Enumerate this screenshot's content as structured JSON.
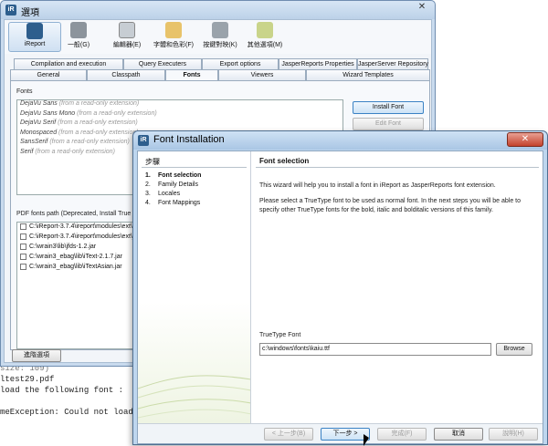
{
  "console": {
    "lines": [
      "size: 109)",
      "ltest29.pdf",
      "load the following font :",
      "",
      "meException: Could not load the fo"
    ]
  },
  "options_window": {
    "title": "選項",
    "toolbar": [
      {
        "label": "iReport",
        "icon": "ireport-icon"
      },
      {
        "label": "一般(G)",
        "icon": "wrench-icon"
      },
      {
        "label": "編輯器(E)",
        "icon": "editor-icon"
      },
      {
        "label": "字體和色彩(F)",
        "icon": "fonts-colors-icon"
      },
      {
        "label": "按鍵對映(K)",
        "icon": "keymap-icon"
      },
      {
        "label": "其他選項(M)",
        "icon": "misc-icon"
      }
    ],
    "tabs_row1": [
      "Compilation and execution",
      "Query Executers",
      "Export options",
      "JasperReports Properties",
      "JasperServer Repository"
    ],
    "tabs_row2": [
      "General",
      "Classpath",
      "Fonts",
      "Viewers",
      "Wizard Templates"
    ],
    "fonts_label": "Fonts",
    "fonts": [
      {
        "name": "DejaVu Sans",
        "note": "(from a read-only extension)"
      },
      {
        "name": "DejaVu Sans Mono",
        "note": "(from a read-only extension)"
      },
      {
        "name": "DejaVu Serif",
        "note": "(from a read-only extension)"
      },
      {
        "name": "Monospaced",
        "note": "(from a read-only extension)"
      },
      {
        "name": "SansSerif",
        "note": "(from a read-only extension)"
      },
      {
        "name": "Serif",
        "note": "(from a read-only extension)"
      }
    ],
    "install_font_label": "Install Font",
    "edit_font_label": "Edit Font",
    "paths_label": "PDF fonts path (Deprecated, Install True Type",
    "paths": [
      "C:\\iReport-3.7.4\\ireport\\modules\\ext\\hsq",
      "C:\\iReport-3.7.4\\ireport\\modules\\ext\\jasp",
      "C:\\wrain3\\lib\\jfds-1.2.jar",
      "C:\\wrain3_ebag\\lib\\iText-2.1.7.jar",
      "C:\\wrain3_ebag\\lib\\iTextAsian.jar"
    ],
    "advanced_label": "進階選項"
  },
  "dialog": {
    "title": "Font Installation",
    "steps_header": "步驟",
    "steps": [
      {
        "n": "1.",
        "label": "Font selection"
      },
      {
        "n": "2.",
        "label": "Family Details"
      },
      {
        "n": "3.",
        "label": "Locales"
      },
      {
        "n": "4.",
        "label": "Font Mappings"
      }
    ],
    "content_header": "Font selection",
    "para1": "This wizard will help you to install a font in iReport as JasperReports font extension.",
    "para2": "Please select a TrueType font to be used as normal font. In the next steps you will be able to specify other TrueType fonts for the bold, italic and bolditalic versions of this family.",
    "ttf_label": "TrueType Font",
    "ttf_value": "c:\\windows\\fonts\\kaiu.ttf",
    "browse_label": "Browse",
    "buttons": {
      "back": "< 上一步(B)",
      "next": "下一步 >",
      "finish": "完成(F)",
      "cancel": "取消",
      "help": "說明(H)"
    }
  }
}
